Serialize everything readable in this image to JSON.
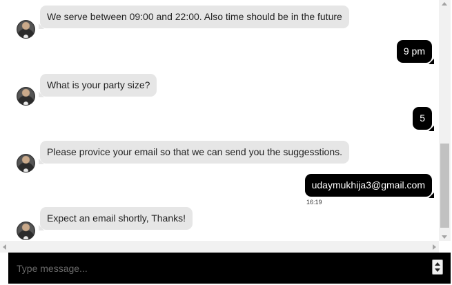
{
  "messages": [
    {
      "sender": "bot",
      "text": "We serve between 09:00 and 22:00. Also time should be in the future"
    },
    {
      "sender": "user",
      "text": "9 pm"
    },
    {
      "sender": "bot",
      "text": "What is your party size?"
    },
    {
      "sender": "user",
      "text": "5"
    },
    {
      "sender": "bot",
      "text": "Please provice your email so that we can send you the suggesstions."
    },
    {
      "sender": "user",
      "text": "udaymukhija3@gmail.com",
      "time": "16:19"
    },
    {
      "sender": "bot",
      "text": "Expect an email shortly, Thanks!"
    }
  ],
  "composer": {
    "placeholder": "Type message..."
  },
  "colors": {
    "bot_bubble": "#e6e6e6",
    "user_bubble": "#000000",
    "composer_bg": "#000000"
  }
}
